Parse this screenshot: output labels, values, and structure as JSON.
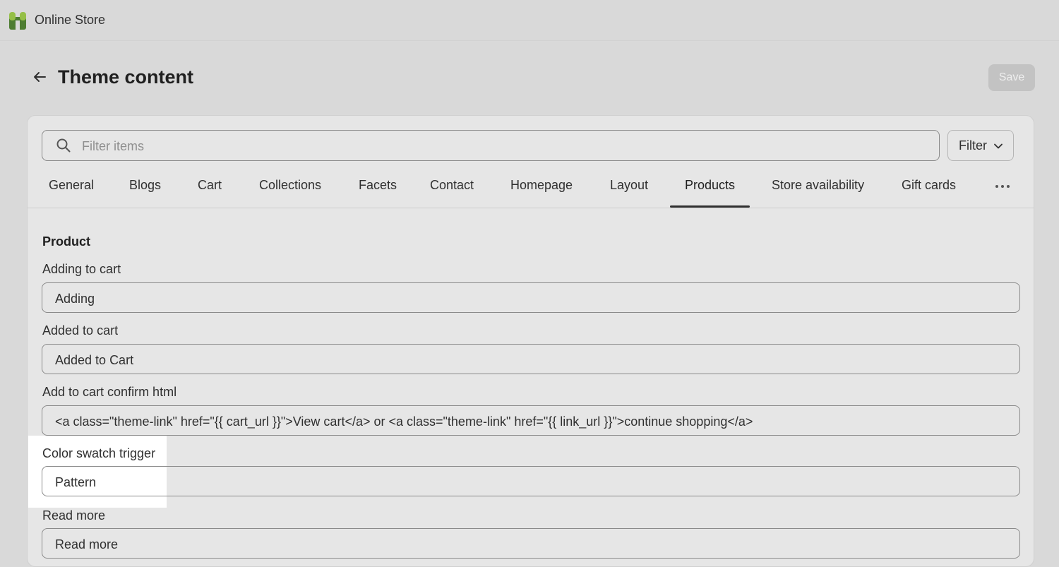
{
  "app": {
    "title": "Online Store"
  },
  "header": {
    "title": "Theme content",
    "save_label": "Save"
  },
  "search": {
    "placeholder": "Filter items",
    "value": ""
  },
  "filter": {
    "label": "Filter"
  },
  "tabs": [
    {
      "label": "General"
    },
    {
      "label": "Blogs"
    },
    {
      "label": "Cart"
    },
    {
      "label": "Collections"
    },
    {
      "label": "Facets"
    },
    {
      "label": "Contact"
    },
    {
      "label": "Homepage"
    },
    {
      "label": "Layout"
    },
    {
      "label": "Products",
      "active": true
    },
    {
      "label": "Store availability"
    },
    {
      "label": "Gift cards"
    }
  ],
  "section": {
    "title": "Product",
    "fields": [
      {
        "label": "Adding to cart",
        "value": "Adding"
      },
      {
        "label": "Added to cart",
        "value": "Added to Cart"
      },
      {
        "label": "Add to cart confirm html",
        "value": "<a class=\"theme-link\" href=\"{{ cart_url }}\">View cart</a> or <a class=\"theme-link\" href=\"{{ link_url }}\">continue shopping</a>"
      },
      {
        "label": "Color swatch trigger",
        "value": "Pattern"
      },
      {
        "label": "Read more",
        "value": "Read more"
      }
    ]
  },
  "icons": {
    "logo": "store-logo-icon",
    "back": "arrow-left-icon",
    "search": "search-icon",
    "filter": "chevron-down-icon",
    "more": "more-horizontal-icon"
  },
  "colors": {
    "logo_green": "#5a8a3c",
    "logo_green_light": "#95bf47"
  }
}
